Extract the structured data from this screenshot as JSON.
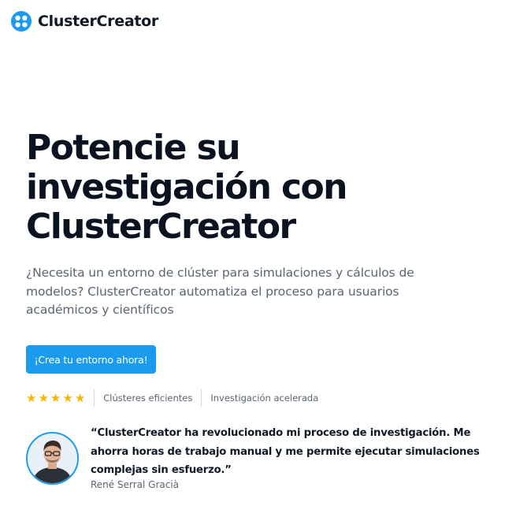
{
  "brand": {
    "name": "ClusterCreator",
    "accent_color": "#1b9bf0",
    "logo_icon": "cluster-logo-icon"
  },
  "hero": {
    "title_lines": [
      "Potencie su",
      "investigación con",
      "ClusterCreator"
    ],
    "subtitle": "¿Necesita un entorno de clúster para simulaciones y cálculos de modelos? ClusterCreator automatiza el proceso para usuarios académicos y científicos",
    "cta_label": "¡Crea tu entorno ahora!"
  },
  "trust": {
    "rating": 5,
    "rating_max": 5,
    "star_icon": "star-icon",
    "star_color": "#f7b500",
    "labels": [
      "Clústeres eficientes",
      "Investigación acelerada"
    ]
  },
  "testimonial": {
    "quote": "“ClusterCreator ha revolucionado mi proceso de investigación. Me ahorra horas de trabajo manual y me permite ejecutar simulaciones complejas sin esfuerzo.”",
    "author": "René Serral Gracià"
  }
}
